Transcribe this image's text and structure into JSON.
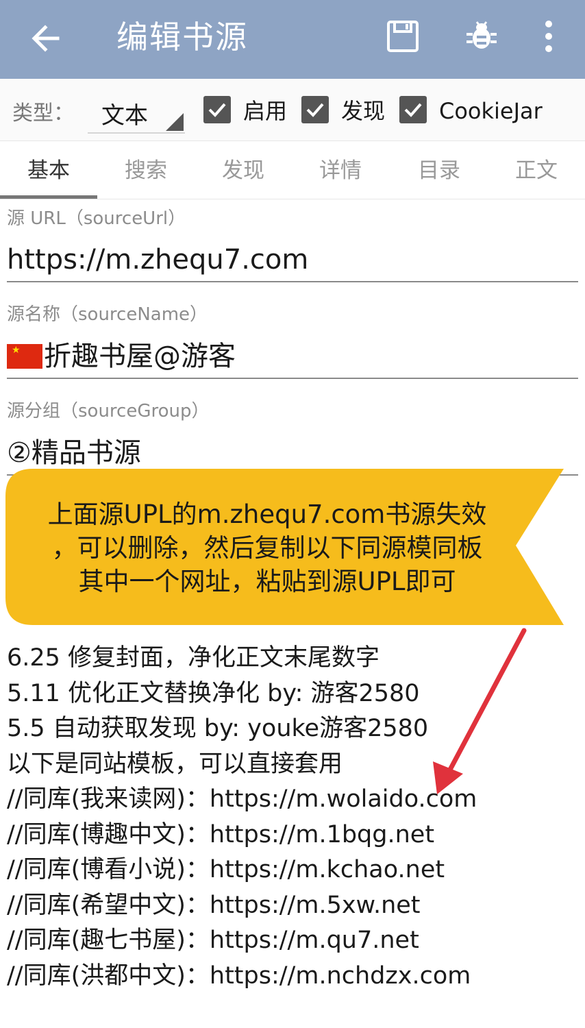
{
  "appbar": {
    "title": "编辑书源",
    "icons": [
      "back-arrow-icon",
      "save-icon",
      "bug-icon",
      "more-vert-icon"
    ]
  },
  "options": {
    "type_label": "类型：",
    "type_value": "文本",
    "enabled_label": "启用",
    "discover_label": "发现",
    "cookiejar_label": "CookieJar"
  },
  "tabs": [
    "基本",
    "搜索",
    "发现",
    "详情",
    "目录",
    "正文"
  ],
  "fields": {
    "source_url_label": "源 URL（sourceUrl）",
    "source_url_value": "https://m.zhequ7.com",
    "source_name_label": "源名称（sourceName）",
    "source_name_value": "折趣书屋@游客",
    "source_group_label": "源分组（sourceGroup）",
    "source_group_value": "②精品书源"
  },
  "description_lines": [
    "6.25 修复封面，净化正文末尾数字",
    "5.11 优化正文替换净化 by: 游客2580",
    "5.5 自动获取发现 by: youke游客2580",
    "以下是同站模板，可以直接套用",
    "//同库(我来读网)：https://m.wolaido.com",
    "//同库(博趣中文)：https://m.1bqg.net",
    "//同库(博看小说)：https://m.kchao.net",
    "//同库(希望中文)：https://m.5xw.net",
    "//同库(趣七书屋)：https://m.qu7.net",
    "//同库(洪都中文)：https://m.nchdzx.com"
  ],
  "callout": {
    "line1": "上面源UPL的m.zhequ7.com书源失效",
    "line2": "，可以删除，然后复制以下同源模同板",
    "line3": "其中一个网址，粘贴到源UPL即可",
    "color": "#f6bc1c"
  },
  "colors": {
    "appbar": "#8ea4c4",
    "annotation_arrow": "#e0323c"
  }
}
